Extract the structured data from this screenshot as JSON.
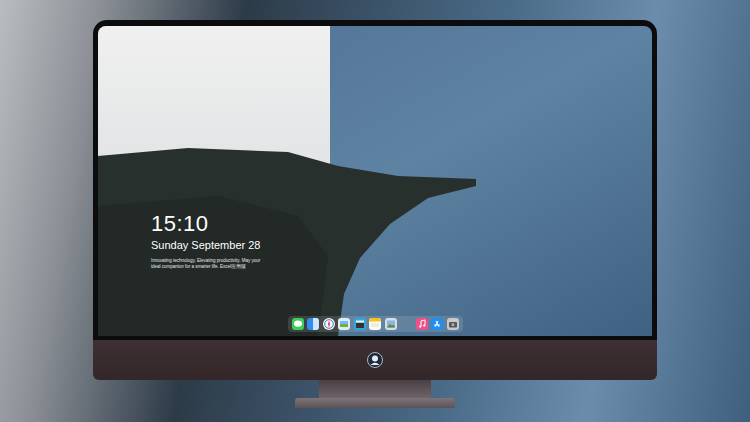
{
  "screen": {
    "lock_info": {
      "time": "15:10",
      "date": "Sunday September 28",
      "tagline": "Innovating technology, Elevating productivity. May your ideal companion for a smarter life. Excel应用版"
    },
    "dock": [
      {
        "kind": "messages"
      },
      {
        "kind": "finder"
      },
      {
        "kind": "safari"
      },
      {
        "kind": "gallery"
      },
      {
        "kind": "clapper"
      },
      {
        "kind": "notes"
      },
      {
        "kind": "photos"
      },
      {
        "kind": "separator"
      },
      {
        "kind": "music"
      },
      {
        "kind": "appstore"
      },
      {
        "kind": "camera"
      }
    ]
  }
}
